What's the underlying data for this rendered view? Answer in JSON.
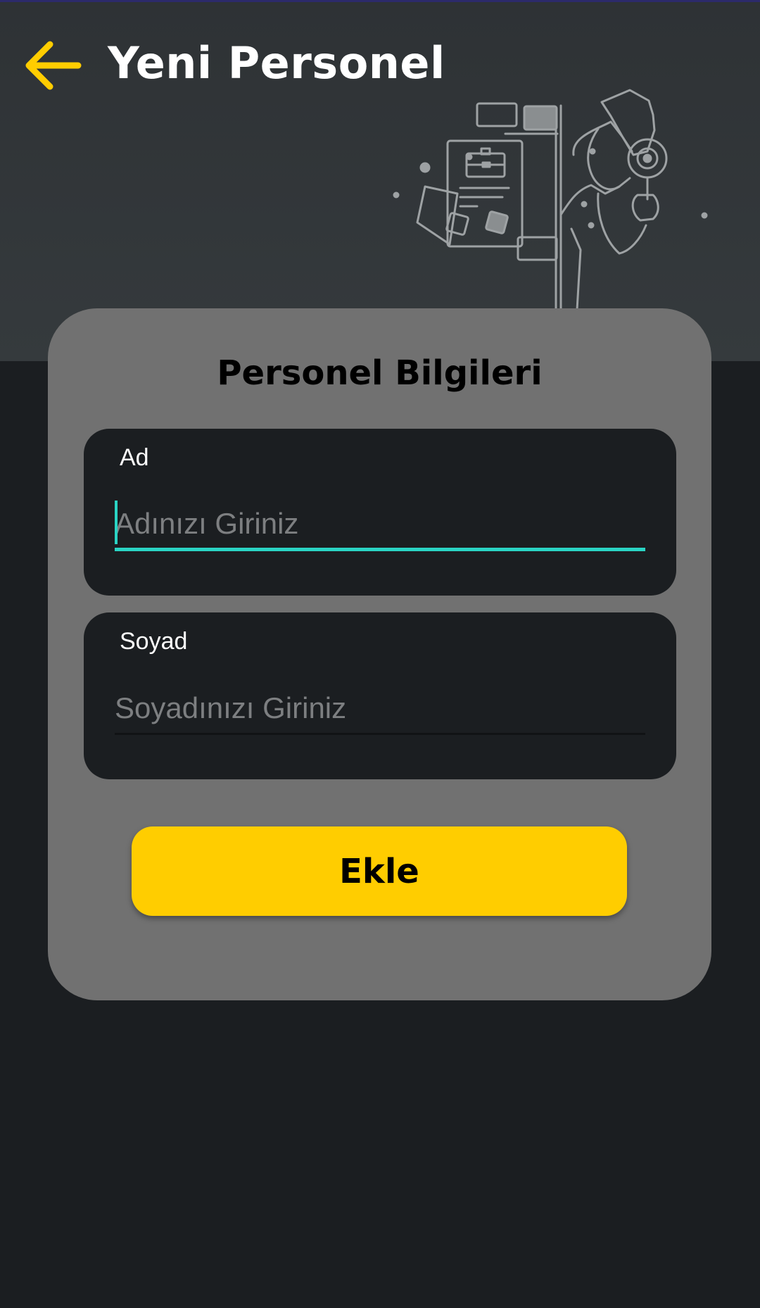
{
  "header": {
    "title": "Yeni Personel",
    "back_icon": "arrow-left-icon",
    "accent_color": "#ffcd00"
  },
  "card": {
    "title": "Personel Bilgileri"
  },
  "form": {
    "first_name": {
      "label": "Ad",
      "value": "",
      "placeholder": "Adınızı Giriniz"
    },
    "last_name": {
      "label": "Soyad",
      "value": "",
      "placeholder": "Soyadınızı Giriniz"
    },
    "focus_color": "#2ad4c4"
  },
  "actions": {
    "add_label": "Ekle",
    "add_color": "#ffcd00"
  }
}
